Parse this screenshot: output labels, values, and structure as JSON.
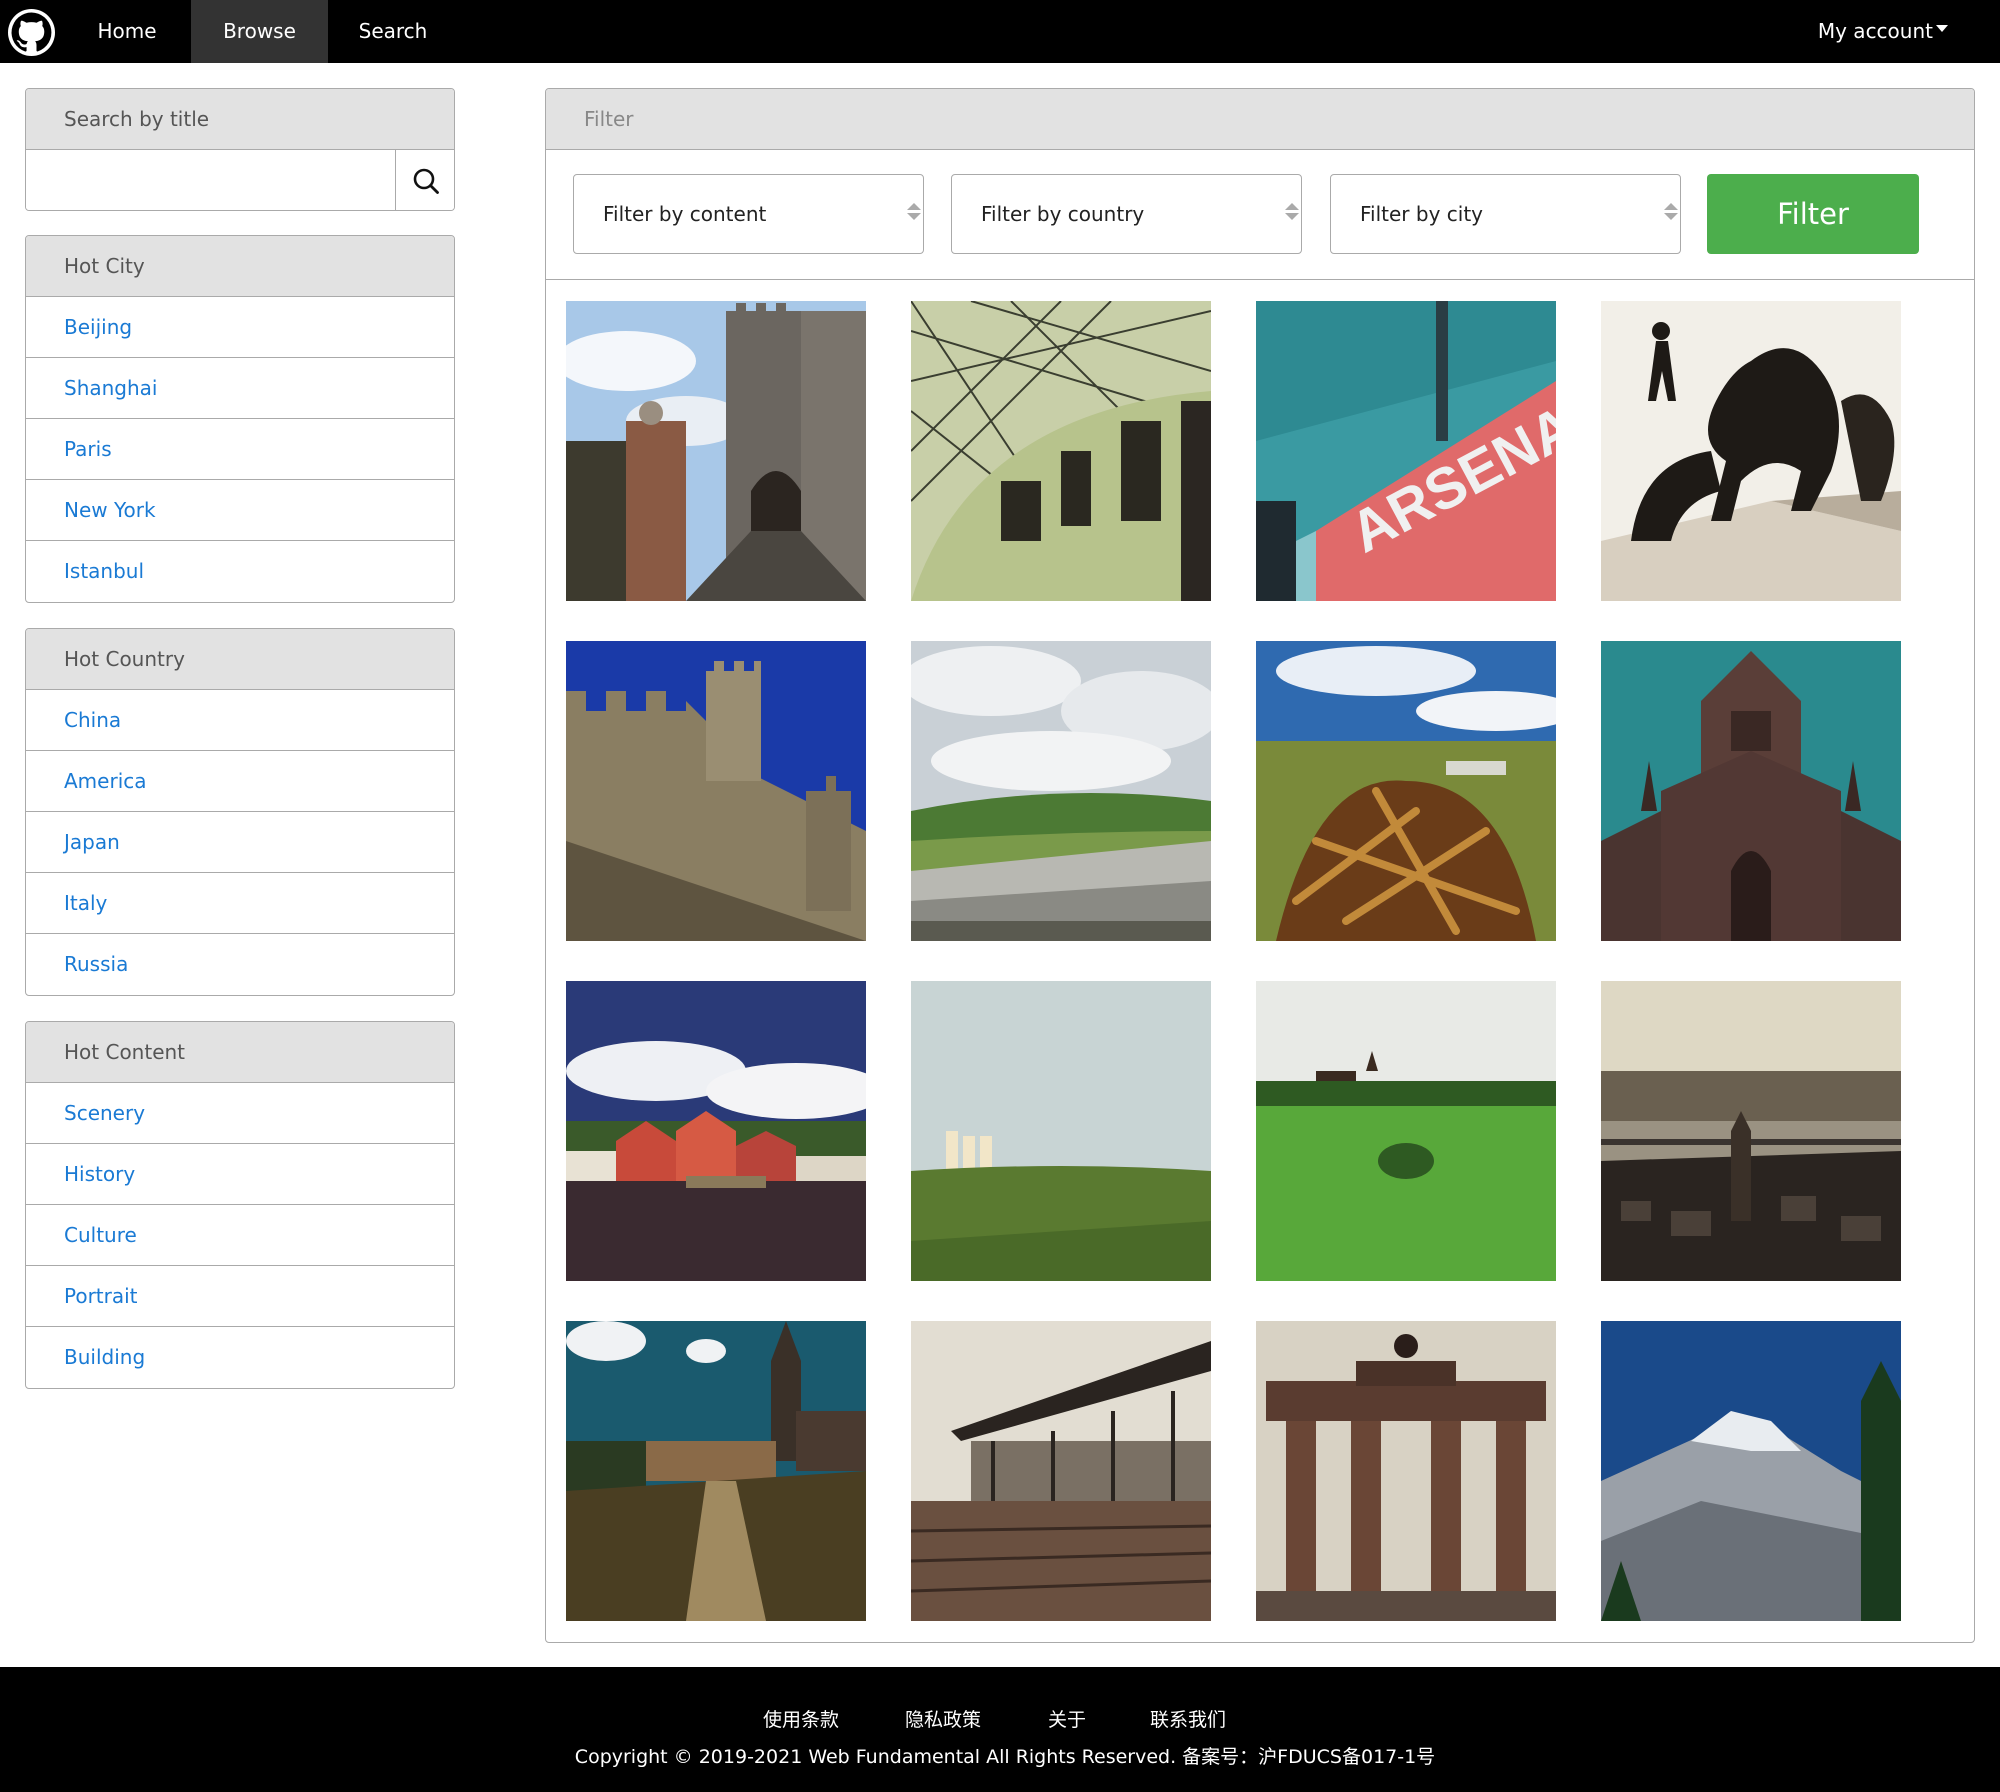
{
  "nav": {
    "logo_icon": "github-logo-icon",
    "home": "Home",
    "browse": "Browse",
    "search": "Search",
    "account": "My account"
  },
  "search_panel": {
    "title": "Search by title",
    "input_value": "",
    "button_icon": "search-icon"
  },
  "hot_city": {
    "title": "Hot City",
    "items": [
      "Beijing",
      "Shanghai",
      "Paris",
      "New York",
      "Istanbul"
    ]
  },
  "hot_country": {
    "title": "Hot Country",
    "items": [
      "China",
      "America",
      "Japan",
      "Italy",
      "Russia"
    ]
  },
  "hot_content": {
    "title": "Hot Content",
    "items": [
      "Scenery",
      "History",
      "Culture",
      "Portrait",
      "Building"
    ]
  },
  "filter": {
    "title": "Filter",
    "content_select": "Filter by content",
    "country_select": "Filter by country",
    "city_select": "Filter by city",
    "button": "Filter"
  },
  "photos": [
    {
      "name": "castle-gate-photo"
    },
    {
      "name": "glass-roof-court-photo"
    },
    {
      "name": "arsenal-stadium-photo"
    },
    {
      "name": "horse-statue-photo"
    },
    {
      "name": "castle-tower-photo"
    },
    {
      "name": "rocky-coast-photo"
    },
    {
      "name": "rusty-junk-field-photo"
    },
    {
      "name": "gothic-church-photo"
    },
    {
      "name": "harbor-houses-photo"
    },
    {
      "name": "green-field-towers-photo"
    },
    {
      "name": "green-meadow-photo"
    },
    {
      "name": "city-river-bridge-photo"
    },
    {
      "name": "garden-church-photo"
    },
    {
      "name": "modern-gallery-photo"
    },
    {
      "name": "brandenburg-gate-photo"
    },
    {
      "name": "snowy-mountain-photo"
    }
  ],
  "footer": {
    "links": [
      "使用条款",
      "隐私政策",
      "关于",
      "联系我们"
    ],
    "copyright": "Copyright © 2019-2021 Web Fundamental All Rights Reserved. 备案号：沪FDUCS备017-1号"
  },
  "colors": {
    "nav_bg": "#000000",
    "active_tab": "#333333",
    "link": "#1a7ad4",
    "filter_button": "#4cae4c",
    "panel_head": "#e2e2e2"
  }
}
